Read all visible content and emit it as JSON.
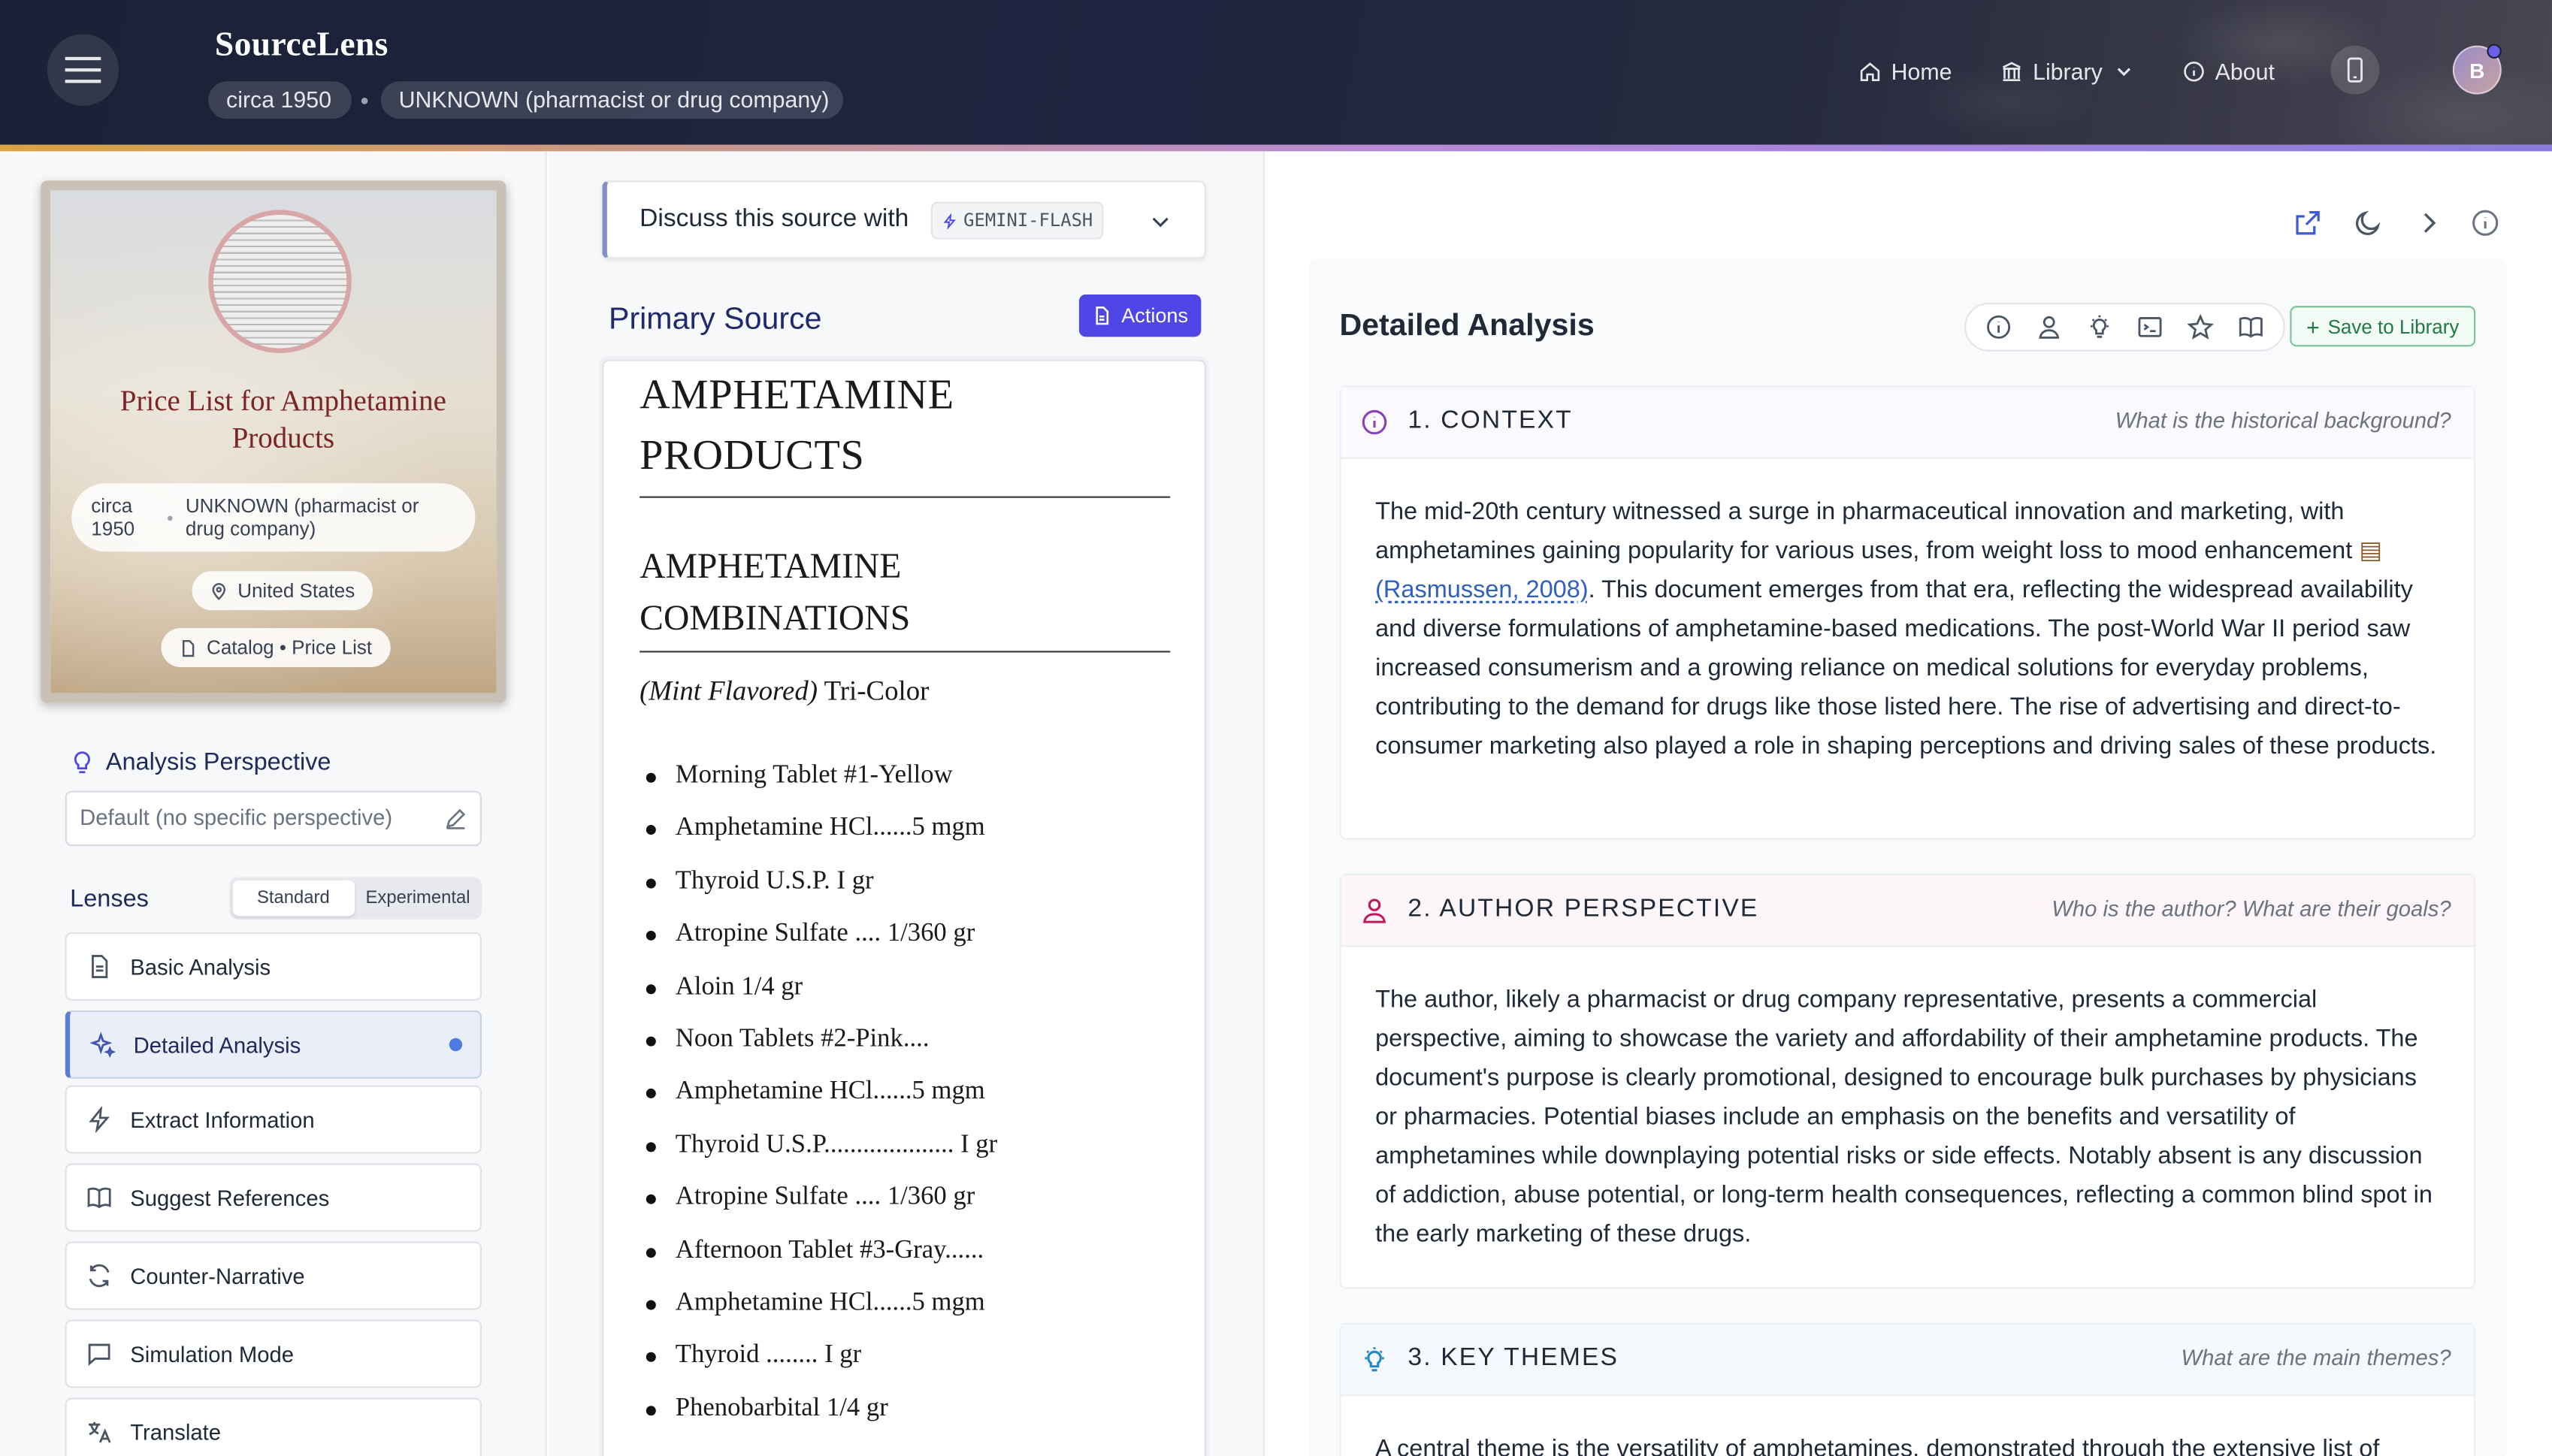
{
  "header": {
    "brand": "SourceLens",
    "date_pill": "circa 1950",
    "author_pill": "UNKNOWN (pharmacist or drug company)",
    "nav": {
      "home": "Home",
      "library": "Library",
      "about": "About"
    },
    "avatar_initial": "B"
  },
  "source_card": {
    "title": "Price List for Amphetamine Products",
    "date": "circa 1950",
    "author": "UNKNOWN (pharmacist or drug company)",
    "location": "United States",
    "type": "Catalog • Price List"
  },
  "perspective": {
    "title": "Analysis Perspective",
    "placeholder": "Default (no specific perspective)"
  },
  "lenses": {
    "title": "Lenses",
    "tabs": [
      "Standard",
      "Experimental"
    ],
    "items": [
      {
        "label": "Basic Analysis",
        "icon": "document-icon"
      },
      {
        "label": "Detailed Analysis",
        "icon": "sparkles-icon",
        "active": true
      },
      {
        "label": "Extract Information",
        "icon": "lightning-icon"
      },
      {
        "label": "Suggest References",
        "icon": "book-icon"
      },
      {
        "label": "Counter-Narrative",
        "icon": "refresh-icon"
      },
      {
        "label": "Simulation Mode",
        "icon": "chat-icon"
      },
      {
        "label": "Translate",
        "icon": "translate-icon"
      }
    ]
  },
  "discuss": {
    "label": "Discuss this source with",
    "model": "GEMINI-FLASH"
  },
  "primary_source": {
    "title": "Primary Source",
    "actions_label": "Actions",
    "heading": "AMPHETAMINE PRODUCTS",
    "subheading": "AMPHETAMINE COMBINATIONS",
    "sub_italic": "(Mint Flavored)",
    "sub_rest": " Tri-Color",
    "items": [
      "Morning Tablet #1-Yellow",
      "Amphetamine HCl......5 mgm",
      "Thyroid U.S.P. I gr",
      "Atropine Sulfate .... 1/360 gr",
      "Aloin 1/4 gr",
      "Noon Tablets #2-Pink....",
      "Amphetamine HCl......5 mgm",
      "Thyroid U.S.P.................... I gr",
      "Atropine Sulfate .... 1/360 gr",
      "Afternoon Tablet #3-Gray......",
      "Amphetamine HCl......5 mgm",
      "Thyroid ........ I gr",
      "Phenobarbital 1/4 gr"
    ]
  },
  "analysis": {
    "title": "Detailed Analysis",
    "save_label": "Save to Library",
    "sections": [
      {
        "name": "1. CONTEXT",
        "question": "What is the historical background?",
        "text_before": "The mid-20th century witnessed a surge in pharmaceutical innovation and marketing, with amphetamines gaining popularity for various uses, from weight loss to mood enhancement ",
        "citation": "(Rasmussen, 2008)",
        "text_after": ". This document emerges from that era, reflecting the widespread availability and diverse formulations of amphetamine-based medications. The post-World War II period saw increased consumerism and a growing reliance on medical solutions for everyday problems, contributing to the demand for drugs like those listed here. The rise of advertising and direct-to-consumer marketing also played a role in shaping perceptions and driving sales of these products."
      },
      {
        "name": "2. AUTHOR PERSPECTIVE",
        "question": "Who is the author? What are their goals?",
        "text": "The author, likely a pharmacist or drug company representative, presents a commercial perspective, aiming to showcase the variety and affordability of their amphetamine products. The document's purpose is clearly promotional, designed to encourage bulk purchases by physicians or pharmacies. Potential biases include an emphasis on the benefits and versatility of amphetamines while downplaying potential risks or side effects. Notably absent is any discussion of addiction, abuse potential, or long-term health consequences, reflecting a common blind spot in the early marketing of these drugs."
      },
      {
        "name": "3. KEY THEMES",
        "question": "What are the main themes?",
        "text": "A central theme is the versatility of amphetamines, demonstrated through the extensive list of"
      }
    ]
  },
  "colors": {
    "accent": "#4f46e5",
    "header_bg": "#1b2136",
    "save_green": "#1f7a46"
  }
}
